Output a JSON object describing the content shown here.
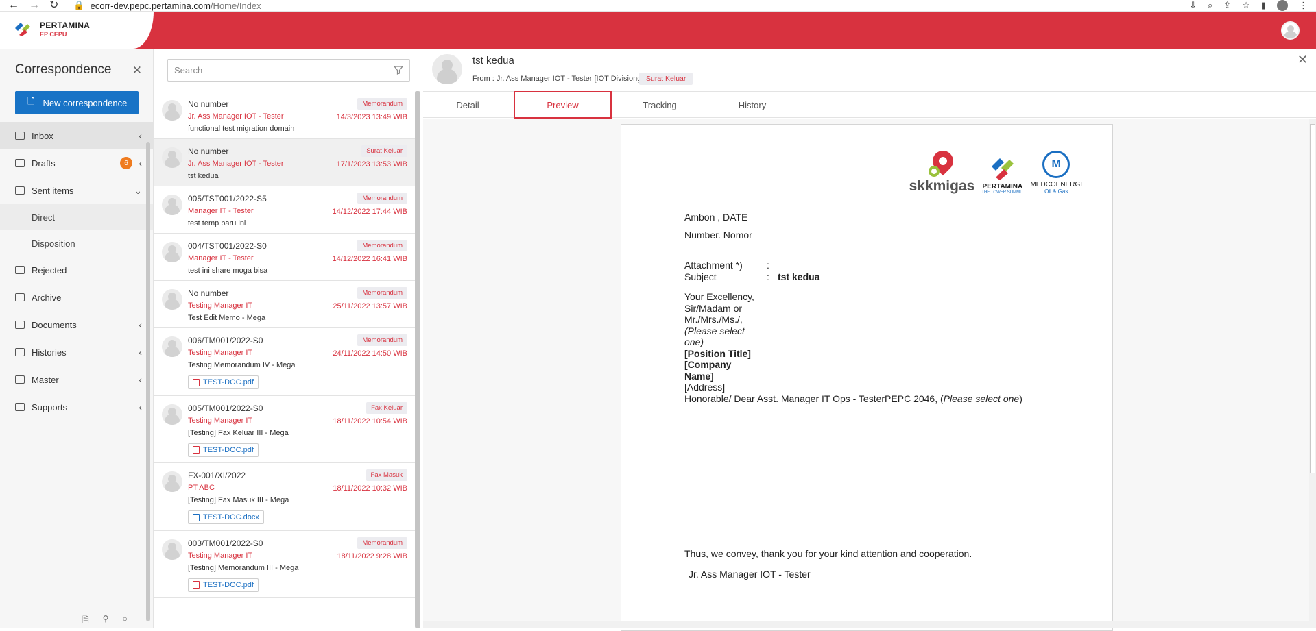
{
  "browser": {
    "url_host": "ecorr-dev.pepc.pertamina.com",
    "url_path": "/Home/Index"
  },
  "brand": {
    "name": "PERTAMINA",
    "sub": "EP CEPU"
  },
  "sidebar": {
    "title": "Correspondence",
    "new_button": "New correspondence",
    "items": [
      {
        "label": "Inbox",
        "icon": "inbox-icon"
      },
      {
        "label": "Drafts",
        "icon": "drafts-icon",
        "badge": "6"
      },
      {
        "label": "Sent items",
        "icon": "sent-icon"
      },
      {
        "label": "Direct"
      },
      {
        "label": "Disposition"
      },
      {
        "label": "Rejected",
        "icon": "rejected-icon"
      },
      {
        "label": "Archive",
        "icon": "archive-icon"
      },
      {
        "label": "Documents",
        "icon": "documents-icon"
      },
      {
        "label": "Histories",
        "icon": "history-icon"
      },
      {
        "label": "Master",
        "icon": "master-icon"
      },
      {
        "label": "Supports",
        "icon": "supports-icon"
      }
    ]
  },
  "search": {
    "placeholder": "Search"
  },
  "list": [
    {
      "number": "No number",
      "sender": "Jr. Ass Manager IOT - Tester",
      "subject": "functional test migration domain",
      "tag": "Memorandum",
      "date": "14/3/2023 13:49 WIB"
    },
    {
      "number": "No number",
      "sender": "Jr. Ass Manager IOT - Tester",
      "subject": "tst kedua",
      "tag": "Surat Keluar",
      "date": "17/1/2023 13:53 WIB"
    },
    {
      "number": "005/TST001/2022-S5",
      "sender": "Manager IT - Tester",
      "subject": "test temp baru ini",
      "tag": "Memorandum",
      "date": "14/12/2022 17:44 WIB"
    },
    {
      "number": "004/TST001/2022-S0",
      "sender": "Manager IT - Tester",
      "subject": "test ini share moga bisa",
      "tag": "Memorandum",
      "date": "14/12/2022 16:41 WIB"
    },
    {
      "number": "No number",
      "sender": "Testing Manager IT",
      "subject": "Test Edit Memo - Mega",
      "tag": "Memorandum",
      "date": "25/11/2022 13:57 WIB"
    },
    {
      "number": "006/TM001/2022-S0",
      "sender": "Testing Manager IT",
      "subject": "Testing Memorandum IV - Mega",
      "tag": "Memorandum",
      "date": "24/11/2022 14:50 WIB",
      "attachment": "TEST-DOC.pdf"
    },
    {
      "number": "005/TM001/2022-S0",
      "sender": "Testing Manager IT",
      "subject": "[Testing] Fax Keluar III - Mega",
      "tag": "Fax Keluar",
      "date": "18/11/2022 10:54 WIB",
      "attachment": "TEST-DOC.pdf"
    },
    {
      "number": "FX-001/XI/2022",
      "sender": "PT ABC",
      "subject": "[Testing] Fax Masuk III - Mega",
      "tag": "Fax Masuk",
      "date": "18/11/2022 10:32 WIB",
      "attachment": "TEST-DOC.docx"
    },
    {
      "number": "003/TM001/2022-S0",
      "sender": "Testing Manager IT",
      "subject": "[Testing] Memorandum III - Mega",
      "tag": "Memorandum",
      "date": "18/11/2022 9:28 WIB",
      "attachment": "TEST-DOC.pdf"
    }
  ],
  "detail": {
    "title": "tst kedua",
    "from": "From : Jr. Ass Manager IOT - Tester [IOT Divisiong]",
    "tag": "Surat Keluar",
    "tabs": [
      "Detail",
      "Preview",
      "Tracking",
      "History"
    ]
  },
  "letter": {
    "logo_skk": "skkmigas",
    "logo_pertamina": "PERTAMINA",
    "logo_pertamina_sub": "THE TOWER SUMMIT",
    "logo_medco": "MEDCOENERGI",
    "logo_medco_sub": "Oil & Gas",
    "place_date": "Ambon , DATE",
    "number": "Number. Nomor",
    "attachment_label": "Attachment *)",
    "subject_label": "Subject",
    "colon": ":",
    "subject_value": "tst kedua",
    "salutation_1": "Your Excellency,",
    "salutation_2": "Sir/Madam or",
    "salutation_3": "Mr./Mrs./Ms./,",
    "salutation_4": "(Please select one)",
    "position_title": "[Position Title]",
    "company_name": "[Company Name]",
    "address": "[Address]",
    "honorable": "Honorable/ Dear Asst. Manager IT Ops - TesterPEPC 2046, (",
    "honorable_italic": "Please select one",
    "honorable_end": ")",
    "closing": "Thus, we convey, thank you for your kind attention and cooperation.",
    "signature": "Jr. Ass Manager IOT - Tester"
  },
  "colors": {
    "brand_red": "#d8323f",
    "primary_blue": "#1873c6",
    "badge_orange": "#ef7b1f"
  }
}
